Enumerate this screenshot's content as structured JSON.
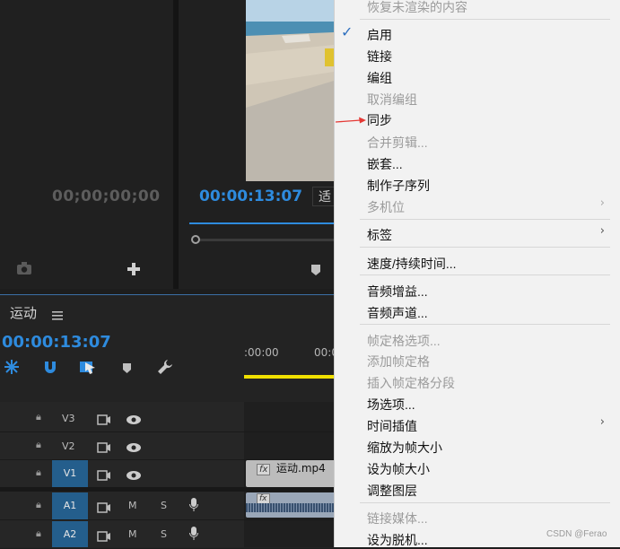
{
  "source_monitor": {
    "timecode": "00;00;00;00"
  },
  "program_monitor": {
    "timecode": "00:00:13:07",
    "fit_label": "适"
  },
  "timeline": {
    "title": "运动",
    "timecode": "00:00:13:07",
    "ruler_labels": [
      ":00:00",
      "00:0"
    ],
    "tracks": [
      {
        "name": "V3"
      },
      {
        "name": "V2"
      },
      {
        "name": "V1"
      },
      {
        "name": "A1"
      },
      {
        "name": "A2"
      }
    ],
    "m_label": "M",
    "s_label": "S",
    "clip_name": "运动.mp4",
    "fx_label": "fx"
  },
  "menu": {
    "items": [
      {
        "label": "恢复未渲染的内容",
        "disabled": true
      },
      {
        "label": "启用",
        "checked": true
      },
      {
        "label": "链接"
      },
      {
        "label": "编组"
      },
      {
        "label": "取消编组",
        "disabled": true
      },
      {
        "label": "同步"
      },
      {
        "label": "合并剪辑...",
        "disabled": true
      },
      {
        "label": "嵌套..."
      },
      {
        "label": "制作子序列"
      },
      {
        "label": "多机位",
        "disabled": true,
        "submenu": true
      },
      {
        "label": "标签",
        "submenu": true
      },
      {
        "label": "速度/持续时间..."
      },
      {
        "label": "音频增益..."
      },
      {
        "label": "音频声道..."
      },
      {
        "label": "帧定格选项...",
        "disabled": true
      },
      {
        "label": "添加帧定格",
        "disabled": true
      },
      {
        "label": "插入帧定格分段",
        "disabled": true
      },
      {
        "label": "场选项..."
      },
      {
        "label": "时间插值",
        "submenu": true
      },
      {
        "label": "缩放为帧大小"
      },
      {
        "label": "设为帧大小"
      },
      {
        "label": "调整图层"
      },
      {
        "label": "链接媒体...",
        "disabled": true
      },
      {
        "label": "设为脱机..."
      }
    ],
    "check_mark": "✓",
    "submenu_arrow": "›"
  },
  "watermark": "CSDN @Ferao",
  "colors": {
    "accent_blue": "#2e8bde",
    "annotation_red": "#e53935",
    "menu_bg": "#f2f2f2"
  }
}
